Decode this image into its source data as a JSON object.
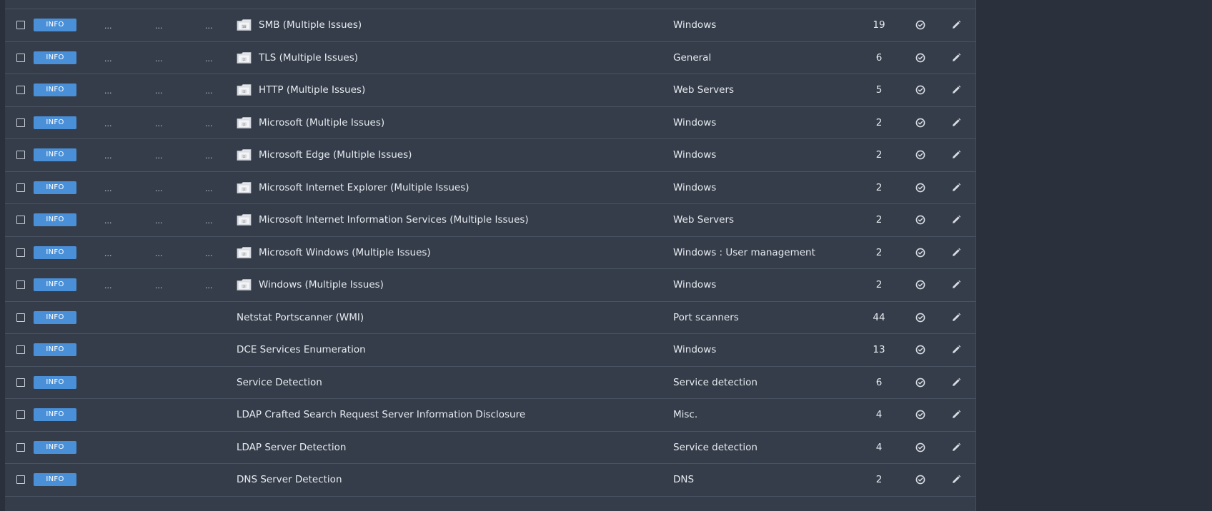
{
  "colors": {
    "background": "#2a313c",
    "table": "#353d4a",
    "info_badge": "#4a90d9",
    "divider": "#4a5361"
  },
  "rows": [
    {
      "severity": "INFO",
      "grouped": true,
      "folder_count": "18",
      "name": "SMB (Multiple Issues)",
      "family": "Windows",
      "count": "19"
    },
    {
      "severity": "INFO",
      "grouped": true,
      "folder_count": "2",
      "name": "TLS (Multiple Issues)",
      "family": "General",
      "count": "6"
    },
    {
      "severity": "INFO",
      "grouped": true,
      "folder_count": "3",
      "name": "HTTP (Multiple Issues)",
      "family": "Web Servers",
      "count": "5"
    },
    {
      "severity": "INFO",
      "grouped": true,
      "folder_count": "2",
      "name": "Microsoft (Multiple Issues)",
      "family": "Windows",
      "count": "2"
    },
    {
      "severity": "INFO",
      "grouped": true,
      "folder_count": "2",
      "name": "Microsoft Edge (Multiple Issues)",
      "family": "Windows",
      "count": "2"
    },
    {
      "severity": "INFO",
      "grouped": true,
      "folder_count": "2",
      "name": "Microsoft Internet Explorer (Multiple Issues)",
      "family": "Windows",
      "count": "2"
    },
    {
      "severity": "INFO",
      "grouped": true,
      "folder_count": "2",
      "name": "Microsoft Internet Information Services (Multiple Issues)",
      "family": "Web Servers",
      "count": "2"
    },
    {
      "severity": "INFO",
      "grouped": true,
      "folder_count": "2",
      "name": "Microsoft Windows (Multiple Issues)",
      "family": "Windows : User management",
      "count": "2"
    },
    {
      "severity": "INFO",
      "grouped": true,
      "folder_count": "2",
      "name": "Windows (Multiple Issues)",
      "family": "Windows",
      "count": "2"
    },
    {
      "severity": "INFO",
      "grouped": false,
      "name": "Netstat Portscanner (WMI)",
      "family": "Port scanners",
      "count": "44"
    },
    {
      "severity": "INFO",
      "grouped": false,
      "name": "DCE Services Enumeration",
      "family": "Windows",
      "count": "13"
    },
    {
      "severity": "INFO",
      "grouped": false,
      "name": "Service Detection",
      "family": "Service detection",
      "count": "6"
    },
    {
      "severity": "INFO",
      "grouped": false,
      "name": "LDAP Crafted Search Request Server Information Disclosure",
      "family": "Misc.",
      "count": "4"
    },
    {
      "severity": "INFO",
      "grouped": false,
      "name": "LDAP Server Detection",
      "family": "Service detection",
      "count": "4"
    },
    {
      "severity": "INFO",
      "grouped": false,
      "name": "DNS Server Detection",
      "family": "DNS",
      "count": "2"
    }
  ],
  "placeholder_dots": "...",
  "icons": {
    "folder": "folder-icon",
    "status": "circle-check-icon",
    "edit": "pencil-edit-icon",
    "checkbox": "checkbox"
  }
}
